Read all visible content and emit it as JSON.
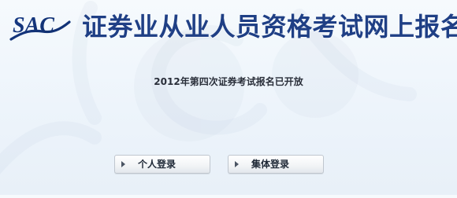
{
  "header": {
    "logo_text": "SAC",
    "title": "证券业从业人员资格考试网上报名"
  },
  "notice": {
    "text": "2012年第四次证券考试报名已开放"
  },
  "actions": {
    "personal_login_label": "个人登录",
    "group_login_label": "集体登录"
  },
  "colors": {
    "brand": "#1f3f85",
    "background": "#edf4fb"
  },
  "icons": {
    "button_arrow": "triangle-right-icon"
  }
}
